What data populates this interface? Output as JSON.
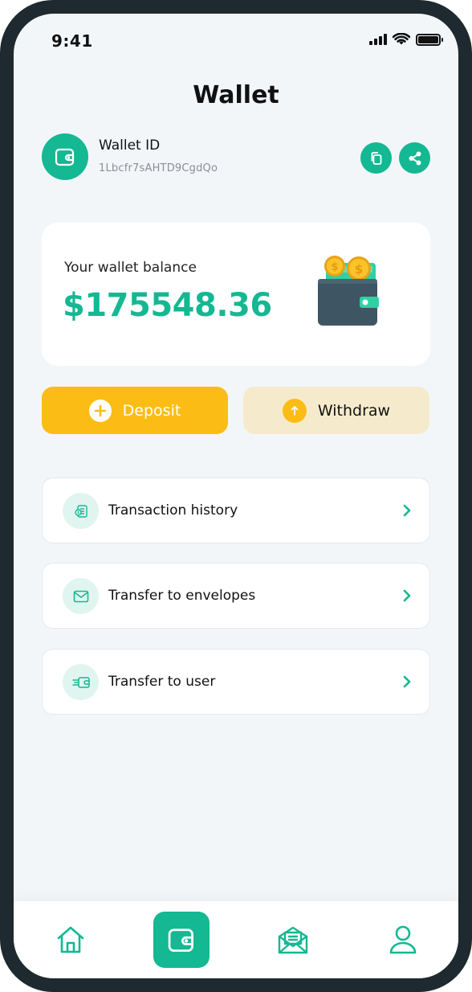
{
  "status_bar": {
    "time": "9:41"
  },
  "header": {
    "title": "Wallet"
  },
  "wallet_id": {
    "label": "Wallet ID",
    "value": "1Lbcfr7sAHTD9CgdQo"
  },
  "balance": {
    "label": "Your wallet balance",
    "amount": "$175548.36"
  },
  "actions": {
    "deposit_label": "Deposit",
    "withdraw_label": "Withdraw"
  },
  "menu": [
    {
      "label": "Transaction history",
      "icon": "document-dollar-icon"
    },
    {
      "label": "Transfer to envelopes",
      "icon": "envelope-icon"
    },
    {
      "label": "Transfer to user",
      "icon": "send-money-icon"
    }
  ],
  "bottom_nav": [
    {
      "name": "home",
      "icon": "home-icon",
      "active": false
    },
    {
      "name": "wallet",
      "icon": "wallet-icon",
      "active": true
    },
    {
      "name": "envelopes",
      "icon": "mail-open-icon",
      "active": false
    },
    {
      "name": "profile",
      "icon": "user-icon",
      "active": false
    }
  ],
  "colors": {
    "accent": "#14b892",
    "deposit": "#fbbd15",
    "withdraw_bg": "#f5ebcc",
    "background": "#f3f6f9",
    "frame": "#1e2a30"
  }
}
